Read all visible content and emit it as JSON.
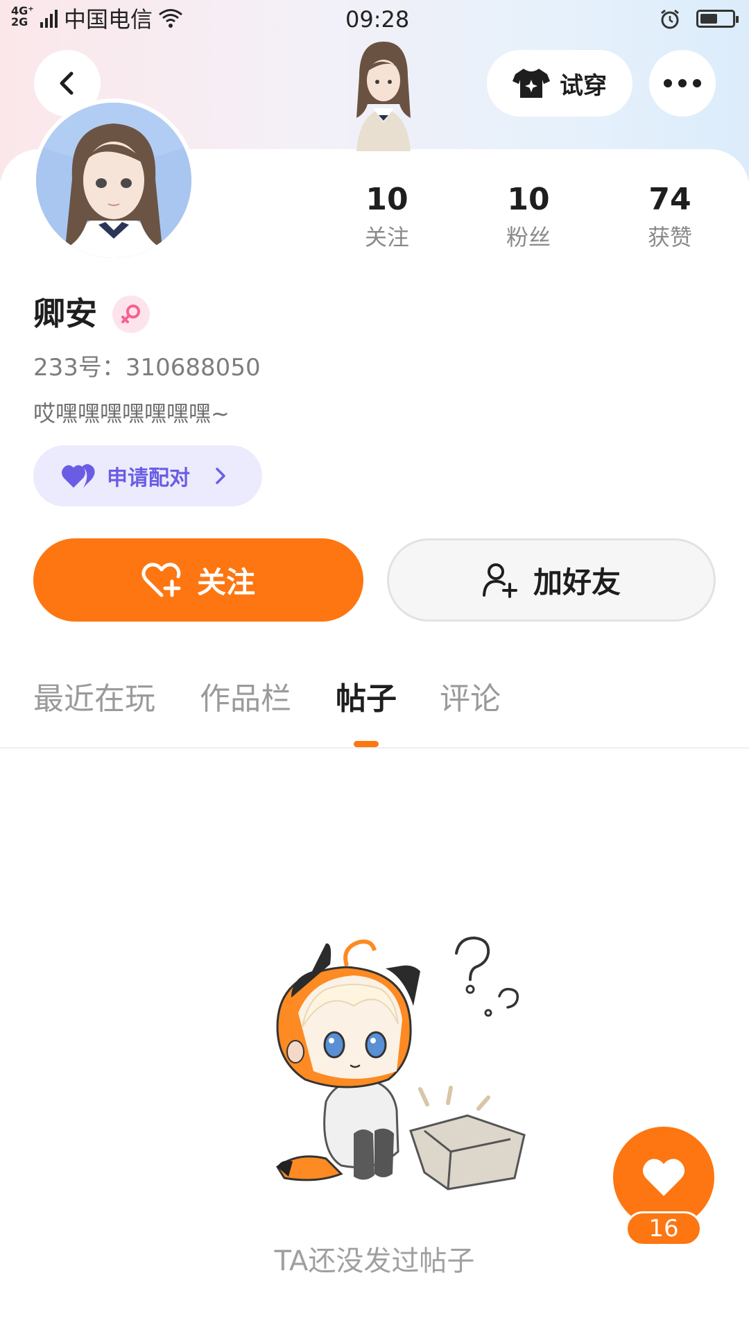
{
  "status_bar": {
    "network_top": "4G⁺",
    "network_bottom": "2G",
    "carrier": "中国电信",
    "time": "09:28",
    "battery_level": 0.55
  },
  "header": {
    "try_on_label": "试穿",
    "icons": {
      "back": "chevron-left-icon",
      "try_on": "tshirt-icon",
      "more": "more-dots-icon"
    }
  },
  "stats": [
    {
      "value": "10",
      "label": "关注"
    },
    {
      "value": "10",
      "label": "粉丝"
    },
    {
      "value": "74",
      "label": "获赞"
    }
  ],
  "profile": {
    "nickname": "卿安",
    "gender_icon": "female-icon",
    "uid": "233号：310688050",
    "bio": "哎嘿嘿嘿嘿嘿嘿嘿~"
  },
  "pair": {
    "label": "申请配对"
  },
  "actions": {
    "follow_label": "关注",
    "add_friend_label": "加好友"
  },
  "tabs": [
    {
      "label": "最近在玩",
      "active": false
    },
    {
      "label": "作品栏",
      "active": false
    },
    {
      "label": "帖子",
      "active": true
    },
    {
      "label": "评论",
      "active": false
    }
  ],
  "empty_state": {
    "message": "TA还没发过帖子"
  },
  "like_fab": {
    "count": "16"
  },
  "colors": {
    "accent": "#fd7611",
    "pair_text": "#6a5de4",
    "pair_bg": "#ecebfd",
    "gender": "#f5628e"
  }
}
